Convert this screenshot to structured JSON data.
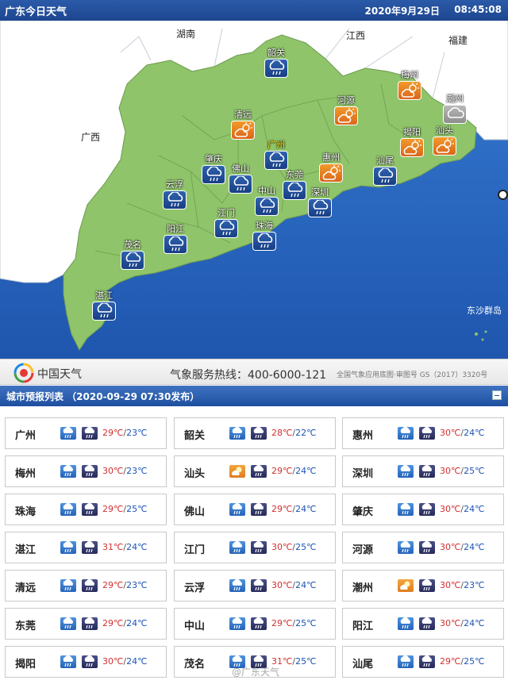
{
  "header": {
    "title": "广东今日天气",
    "date": "2020年9月29日",
    "time": "08:45:08"
  },
  "map": {
    "regions": [
      "湖南",
      "江西",
      "福建",
      "广西"
    ],
    "cities": [
      {
        "name": "韶关",
        "icon": "rain"
      },
      {
        "name": "梅州",
        "icon": "sun-cloud"
      },
      {
        "name": "潮州",
        "icon": "cloud"
      },
      {
        "name": "河源",
        "icon": "sun-cloud"
      },
      {
        "name": "清远",
        "icon": "sun-cloud"
      },
      {
        "name": "广州",
        "icon": "rain"
      },
      {
        "name": "揭阳",
        "icon": "sun-cloud"
      },
      {
        "name": "汕头",
        "icon": "sun-cloud"
      },
      {
        "name": "惠州",
        "icon": "sun-cloud"
      },
      {
        "name": "肇庆",
        "icon": "rain"
      },
      {
        "name": "佛山",
        "icon": "rain"
      },
      {
        "name": "汕尾",
        "icon": "rain"
      },
      {
        "name": "云浮",
        "icon": "rain"
      },
      {
        "name": "东莞",
        "icon": "rain"
      },
      {
        "name": "中山",
        "icon": "rain"
      },
      {
        "name": "深圳",
        "icon": "rain"
      },
      {
        "name": "江门",
        "icon": "rain"
      },
      {
        "name": "珠海",
        "icon": "rain"
      },
      {
        "name": "茂名",
        "icon": "rain"
      },
      {
        "name": "阳江",
        "icon": "rain"
      },
      {
        "name": "湛江",
        "icon": "rain"
      }
    ],
    "islands_label": "东沙群岛"
  },
  "band": {
    "brand": "中国天气",
    "hotline": "气象服务热线：400-6000-121",
    "review": "全国气象应用底图·审图号 GS（2017）3320号"
  },
  "list": {
    "title": "城市预报列表 （2020-09-29 07:30发布）",
    "rows": [
      [
        {
          "name": "广州",
          "hi": "29℃",
          "lo": "23℃",
          "day": "rain"
        },
        {
          "name": "韶关",
          "hi": "28℃",
          "lo": "22℃",
          "day": "rain"
        },
        {
          "name": "惠州",
          "hi": "30℃",
          "lo": "24℃",
          "day": "rain"
        }
      ],
      [
        {
          "name": "梅州",
          "hi": "30℃",
          "lo": "23℃",
          "day": "rain"
        },
        {
          "name": "汕头",
          "hi": "29℃",
          "lo": "24℃",
          "day": "sun"
        },
        {
          "name": "深圳",
          "hi": "30℃",
          "lo": "25℃",
          "day": "rain"
        }
      ],
      [
        {
          "name": "珠海",
          "hi": "29℃",
          "lo": "25℃",
          "day": "rain"
        },
        {
          "name": "佛山",
          "hi": "29℃",
          "lo": "24℃",
          "day": "rain"
        },
        {
          "name": "肇庆",
          "hi": "30℃",
          "lo": "24℃",
          "day": "rain"
        }
      ],
      [
        {
          "name": "湛江",
          "hi": "31℃",
          "lo": "24℃",
          "day": "rain"
        },
        {
          "name": "江门",
          "hi": "30℃",
          "lo": "25℃",
          "day": "rain"
        },
        {
          "name": "河源",
          "hi": "30℃",
          "lo": "24℃",
          "day": "rain"
        }
      ],
      [
        {
          "name": "清远",
          "hi": "29℃",
          "lo": "23℃",
          "day": "rain"
        },
        {
          "name": "云浮",
          "hi": "30℃",
          "lo": "24℃",
          "day": "rain"
        },
        {
          "name": "潮州",
          "hi": "30℃",
          "lo": "23℃",
          "day": "sun"
        }
      ],
      [
        {
          "name": "东莞",
          "hi": "29℃",
          "lo": "24℃",
          "day": "rain"
        },
        {
          "name": "中山",
          "hi": "29℃",
          "lo": "25℃",
          "day": "rain"
        },
        {
          "name": "阳江",
          "hi": "30℃",
          "lo": "24℃",
          "day": "rain"
        }
      ],
      [
        {
          "name": "揭阳",
          "hi": "30℃",
          "lo": "24℃",
          "day": "rain"
        },
        {
          "name": "茂名",
          "hi": "31℃",
          "lo": "25℃",
          "day": "rain"
        },
        {
          "name": "汕尾",
          "hi": "29℃",
          "lo": "25℃",
          "day": "rain"
        }
      ]
    ]
  },
  "watermark": "@广东天气"
}
